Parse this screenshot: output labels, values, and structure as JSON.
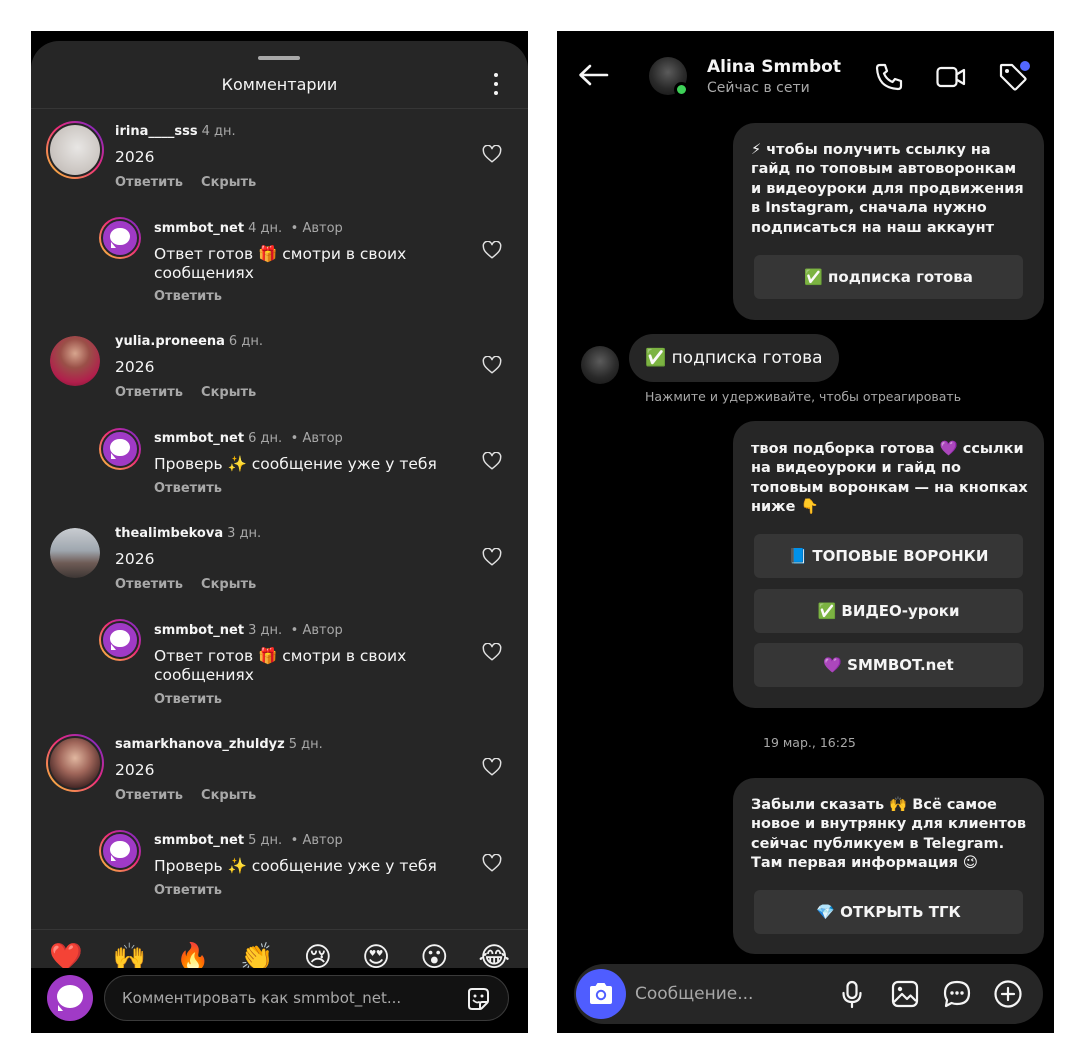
{
  "comments_panel": {
    "title": "Комментарии",
    "comments": [
      {
        "user": "irina____sss",
        "time": "4 дн.",
        "text": "2026",
        "actions": [
          "Ответить",
          "Скрыть"
        ],
        "author_badge": ""
      },
      {
        "user": "smmbot_net",
        "time": "4 дн.",
        "author_badge": "• Автор",
        "text": "Ответ готов 🎁 смотри в своих сообщениях",
        "actions": [
          "Ответить"
        ]
      },
      {
        "user": "yulia.proneena",
        "time": "6 дн.",
        "text": "2026",
        "actions": [
          "Ответить",
          "Скрыть"
        ],
        "author_badge": ""
      },
      {
        "user": "smmbot_net",
        "time": "6 дн.",
        "author_badge": "• Автор",
        "text": "Проверь ✨ сообщение уже у тебя",
        "actions": [
          "Ответить"
        ]
      },
      {
        "user": "thealimbekova",
        "time": "3 дн.",
        "text": "2026",
        "actions": [
          "Ответить",
          "Скрыть"
        ],
        "author_badge": ""
      },
      {
        "user": "smmbot_net",
        "time": "3 дн.",
        "author_badge": "• Автор",
        "text": "Ответ готов 🎁 смотри в своих сообщениях",
        "actions": [
          "Ответить"
        ]
      },
      {
        "user": "samarkhanova_zhuldyz",
        "time": "5 дн.",
        "text": "2026",
        "actions": [
          "Ответить",
          "Скрыть"
        ],
        "author_badge": ""
      },
      {
        "user": "smmbot_net",
        "time": "5 дн.",
        "author_badge": "• Автор",
        "text": "Проверь ✨ сообщение уже у тебя",
        "actions": [
          "Ответить"
        ]
      }
    ],
    "emoji_reactions": [
      "❤️",
      "🙌",
      "🔥",
      "👏",
      "😢",
      "😍",
      "😮",
      "😂"
    ],
    "input_placeholder": "Комментировать как smmbot_net..."
  },
  "dm_panel": {
    "contact_name": "Alina Smmbot",
    "contact_status": "Сейчас в сети",
    "messages": [
      {
        "type": "bot",
        "text": "⚡ чтобы получить ссылку на гайд по топовым автоворонкам и видеоуроки для продвижения в Instagram, сначала нужно подписаться на наш аккаунт",
        "buttons": [
          "✅ подписка готова"
        ]
      },
      {
        "type": "user",
        "text": "✅ подписка готова"
      },
      {
        "type": "hint",
        "text": "Нажмите и удерживайте, чтобы отреагировать"
      },
      {
        "type": "bot",
        "text": "твоя подборка готова 💜 ссылки на видеоуроки и гайд по топовым воронкам — на кнопках ниже 👇",
        "buttons": [
          "📘 ТОПОВЫЕ ВОРОНКИ",
          "✅ ВИДЕО-уроки",
          "💜 SMMBOT.net"
        ]
      },
      {
        "type": "timestamp",
        "text": "19 мар., 16:25"
      },
      {
        "type": "bot",
        "text": "Забыли сказать 🙌 Всё самое новое и внутрянку для клиентов сейчас публикуем в Telegram. Там первая информация 😉",
        "buttons": [
          "💎 ОТКРЫТЬ ТГК"
        ]
      }
    ],
    "composer_placeholder": "Сообщение..."
  },
  "colors": {
    "sheet_bg": "#262626",
    "screen_bg": "#000000",
    "accent_blue": "#4f5dff",
    "online_green": "#3ed158",
    "brand_purple": "#a03ac6"
  }
}
